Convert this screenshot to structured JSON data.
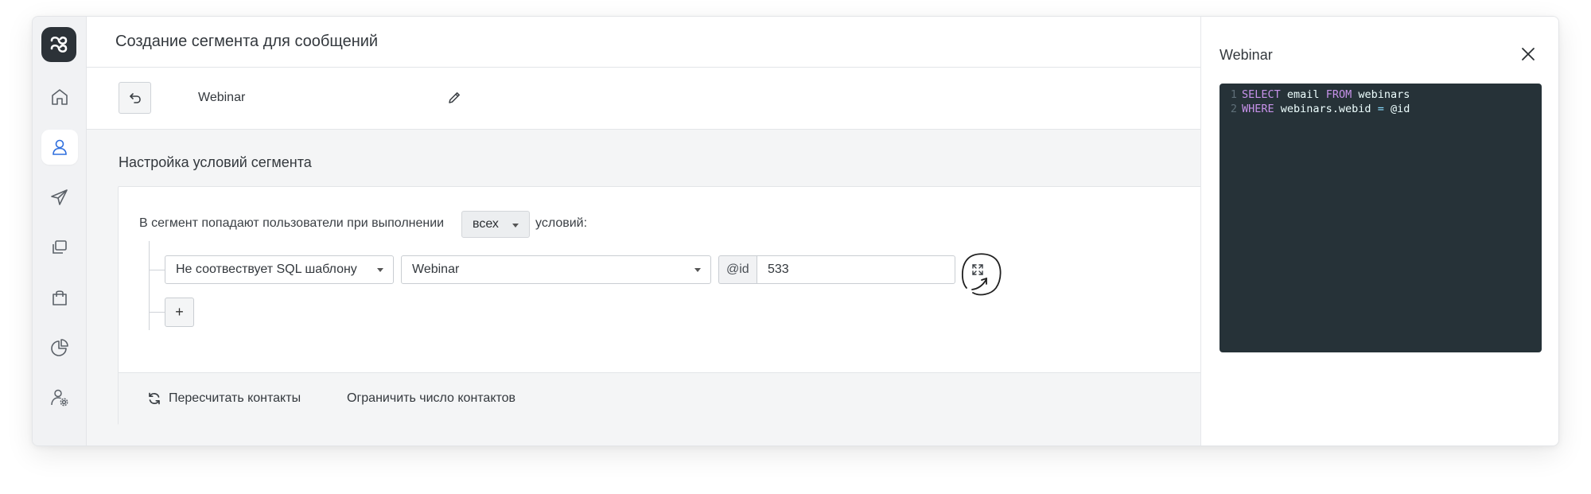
{
  "header": {
    "title": "Создание сегмента для сообщений"
  },
  "toolbar": {
    "segment_name": "Webinar"
  },
  "section": {
    "title": "Настройка условий сегмента"
  },
  "rule": {
    "prefix": "В сегмент попадают пользователи при выполнении",
    "match_mode": "всех",
    "suffix": "условий:"
  },
  "condition": {
    "type": "Не соотвествует SQL шаблону",
    "template": "Webinar",
    "param_label": "@id",
    "param_value": "533",
    "add_label": "+"
  },
  "footer": {
    "recalc_label": "Пересчитать контакты",
    "limit_label": "Ограничить число контактов"
  },
  "panel": {
    "title": "Webinar",
    "code": [
      {
        "n": "1",
        "t1": "SELECT",
        "t2": " email ",
        "t3": "FROM",
        "t4": " webinars"
      },
      {
        "n": "2",
        "t1": "WHERE",
        "t2": " webinars.webid ",
        "t3": "=",
        "t4": " @id"
      }
    ]
  },
  "sidebar": {
    "items": [
      {
        "name": "home-icon",
        "active": false
      },
      {
        "name": "user-icon",
        "active": true
      },
      {
        "name": "send-icon",
        "active": false
      },
      {
        "name": "copy-icon",
        "active": false
      },
      {
        "name": "bag-icon",
        "active": false
      },
      {
        "name": "pie-chart-icon",
        "active": false
      },
      {
        "name": "user-settings-icon",
        "active": false
      }
    ]
  },
  "colors": {
    "accent": "#2f6fde",
    "editor_bg": "#263238",
    "keyword": "#c792ea"
  }
}
